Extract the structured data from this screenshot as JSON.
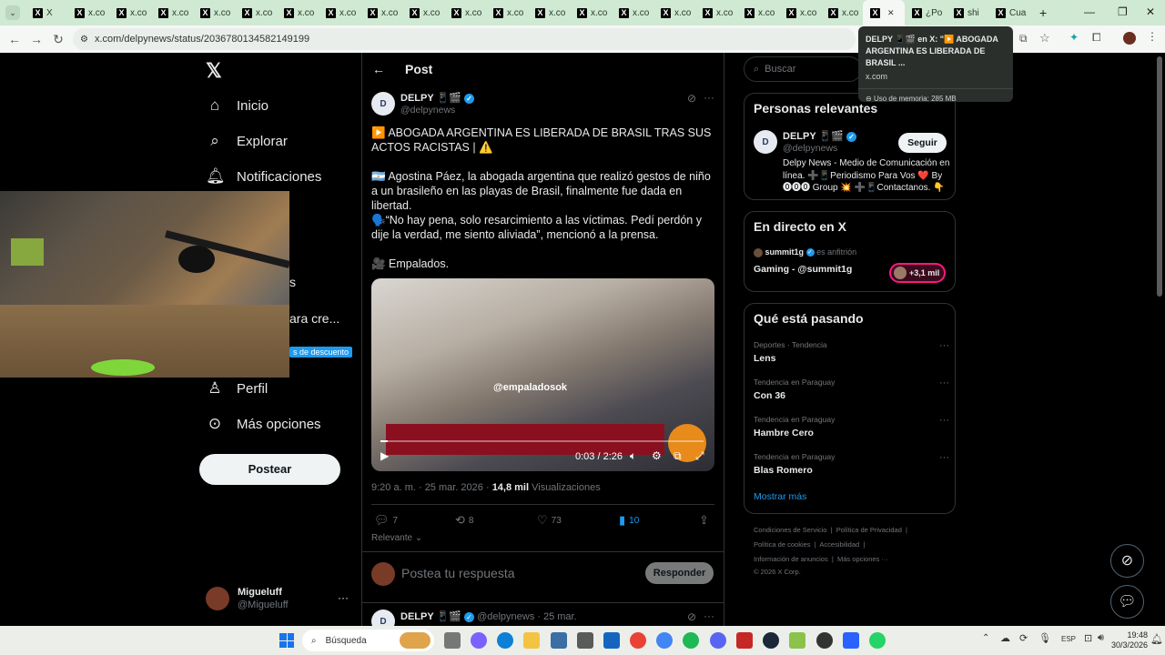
{
  "browser": {
    "tabs": [
      {
        "label": "X"
      },
      {
        "label": "x.co"
      },
      {
        "label": "x.co"
      },
      {
        "label": "x.co"
      },
      {
        "label": "x.co"
      },
      {
        "label": "x.co"
      },
      {
        "label": "x.co"
      },
      {
        "label": "x.co"
      },
      {
        "label": "x.co"
      },
      {
        "label": "x.co"
      },
      {
        "label": "x.co"
      },
      {
        "label": "x.co"
      },
      {
        "label": "x.co"
      },
      {
        "label": "x.co"
      },
      {
        "label": "x.co"
      },
      {
        "label": "x.co"
      },
      {
        "label": "x.co"
      },
      {
        "label": "x.co"
      },
      {
        "label": "x.co"
      },
      {
        "label": "x.co"
      },
      {
        "label": ""
      },
      {
        "label": "¿Po"
      },
      {
        "label": "shi"
      },
      {
        "label": "Cua"
      }
    ],
    "new_tab": "+",
    "url": "x.com/delpynews/status/2036780134582149199",
    "tooltip": {
      "title": "DELPY 📱🎬 en X: \"▶️ ABOGADA ARGENTINA ES LIBERADA DE BRASIL ...",
      "domain": "x.com",
      "memory": "Uso de memoria: 285 MB"
    }
  },
  "nav": {
    "items": [
      {
        "label": "Inicio",
        "icon": "home-icon"
      },
      {
        "label": "Explorar",
        "icon": "search-icon"
      },
      {
        "label": "Notificaciones",
        "icon": "bell-icon"
      },
      {
        "label": "Perfil",
        "icon": "person-icon"
      },
      {
        "label": "Más opciones",
        "icon": "more-circle-icon"
      }
    ],
    "partial_1": "s",
    "partial_2": "ara cre...",
    "discount": "s de descuento",
    "post_button": "Postear",
    "account": {
      "name": "Migueluff",
      "handle": "@Migueluff"
    }
  },
  "post": {
    "header": "Post",
    "author": "DELPY 📱🎬",
    "handle": "@delpynews",
    "para1": "▶️ ABOGADA ARGENTINA ES LIBERADA DE BRASIL TRAS SUS ACTOS RACISTAS | ⚠️",
    "para2": "🇦🇷 Agostina Páez, la abogada argentina que realizó gestos de niño a un brasileño en las playas de Brasil, finalmente fue dada en libertad.",
    "para3": "🗣️“No hay pena, solo resarcimiento a las víctimas. Pedí perdón y dije la verdad, me siento aliviada”, mencionó a la prensa.",
    "para4": "🎥 Empalados.",
    "video": {
      "watermark": "@empaladosok",
      "time": "0:03 / 2:26",
      "progress": 0.023
    },
    "time": "9:20 a. m. · 25 mar. 2026",
    "views_count": "14,8 mil",
    "views_label": "Visualizaciones",
    "replies": "7",
    "reposts": "8",
    "likes": "73",
    "bookmarks": "10",
    "sort": "Relevante",
    "reply_placeholder": "Postea tu respuesta",
    "reply_button": "Responder",
    "next_author": "DELPY 📱🎬",
    "next_meta": "@delpynews · 25 mar."
  },
  "sidebar": {
    "search_placeholder": "Buscar",
    "relevant": {
      "title": "Personas relevantes",
      "name": "DELPY 📱🎬",
      "handle": "@delpynews",
      "follow": "Seguir",
      "bio": "Delpy News - Medio de Comunicación en línea. ➕📱Periodismo Para Vos ❤️ By ⓿⓿⓿ Group 💥 ➕📱Contactanos. 👇"
    },
    "live": {
      "title": "En directo en X",
      "host": "summit1g",
      "host_suffix": "es anfitrión",
      "stream": "Gaming - @summit1g",
      "listeners": "+3,1 mil"
    },
    "trends": {
      "title": "Qué está pasando",
      "items": [
        {
          "category": "Deportes · Tendencia",
          "name": "Lens"
        },
        {
          "category": "Tendencia en Paraguay",
          "name": "Con 36"
        },
        {
          "category": "Tendencia en Paraguay",
          "name": "Hambre Cero"
        },
        {
          "category": "Tendencia en Paraguay",
          "name": "Blas Romero"
        }
      ],
      "more": "Mostrar más"
    },
    "footer": {
      "line1": [
        "Condiciones de Servicio",
        "Política de Privacidad"
      ],
      "line2": [
        "Política de cookies",
        "Accesibilidad"
      ],
      "line3": [
        "Información de anuncios",
        "Más opciones ···"
      ],
      "copyright": "© 2026 X Corp."
    }
  },
  "taskbar": {
    "search": "Búsqueda",
    "lang": "ESP",
    "time": "19:48",
    "date": "30/3/2026"
  }
}
